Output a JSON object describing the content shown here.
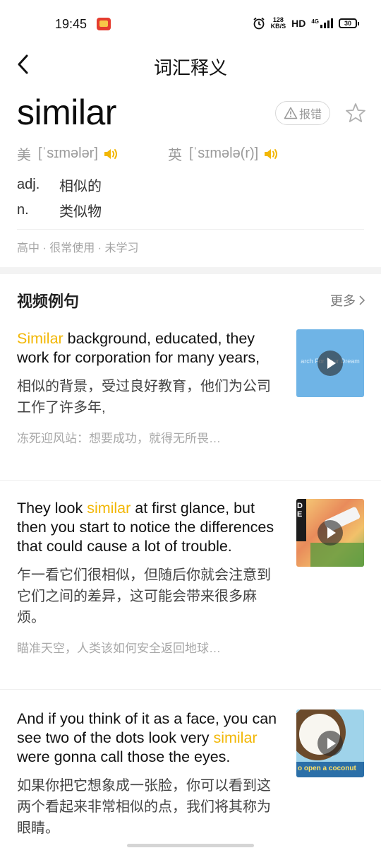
{
  "status_bar": {
    "time": "19:45",
    "speed_top": "128",
    "speed_bottom": "KB/S",
    "hd": "HD",
    "network": "4G",
    "battery": "30"
  },
  "nav": {
    "title": "词汇释义"
  },
  "word": {
    "text": "similar",
    "report_label": "报错"
  },
  "pronunciation": {
    "us": {
      "label": "美",
      "phonetic": "[ˈsɪmələr]"
    },
    "uk": {
      "label": "英",
      "phonetic": "[ˈsɪmələ(r)]"
    }
  },
  "definitions": [
    {
      "pos": "adj.",
      "meaning": "相似的"
    },
    {
      "pos": "n.",
      "meaning": "类似物"
    }
  ],
  "tags": "高中 · 很常使用 · 未学习",
  "video_section": {
    "title": "视频例句",
    "more_label": "更多"
  },
  "examples": [
    {
      "en_before": "",
      "en_highlight": "Similar",
      "en_after": " background, educated, they work for corporation for many years,",
      "cn": "相似的背景，受过良好教育，他们为公司工作了许多年,",
      "source": "冻死迎风站：想要成功，就得无所畏…",
      "thumb_text": "arch For Your Dream"
    },
    {
      "en_before": "They look ",
      "en_highlight": "similar",
      "en_after": " at first glance, but then you start to notice the differences that could cause a lot of trouble.",
      "cn": "乍一看它们很相似，但随后你就会注意到它们之间的差异，这可能会带来很多麻烦。",
      "source": "瞄准天空，人类该如何安全返回地球…",
      "thumb_text": "DE"
    },
    {
      "en_before": "And if you think of it as a face, you can see two of the dots look very ",
      "en_highlight": "similar",
      "en_after": " were gonna call those the eyes.",
      "cn": "如果你把它想象成一张脸，你可以看到这两个看起来非常相似的点，我们将其称为眼睛。",
      "source": "",
      "thumb_text": "o open a coconut"
    }
  ],
  "colors": {
    "highlight": "#f2b705",
    "speaker": "#f2b705",
    "divider": "#f3f3f3"
  }
}
